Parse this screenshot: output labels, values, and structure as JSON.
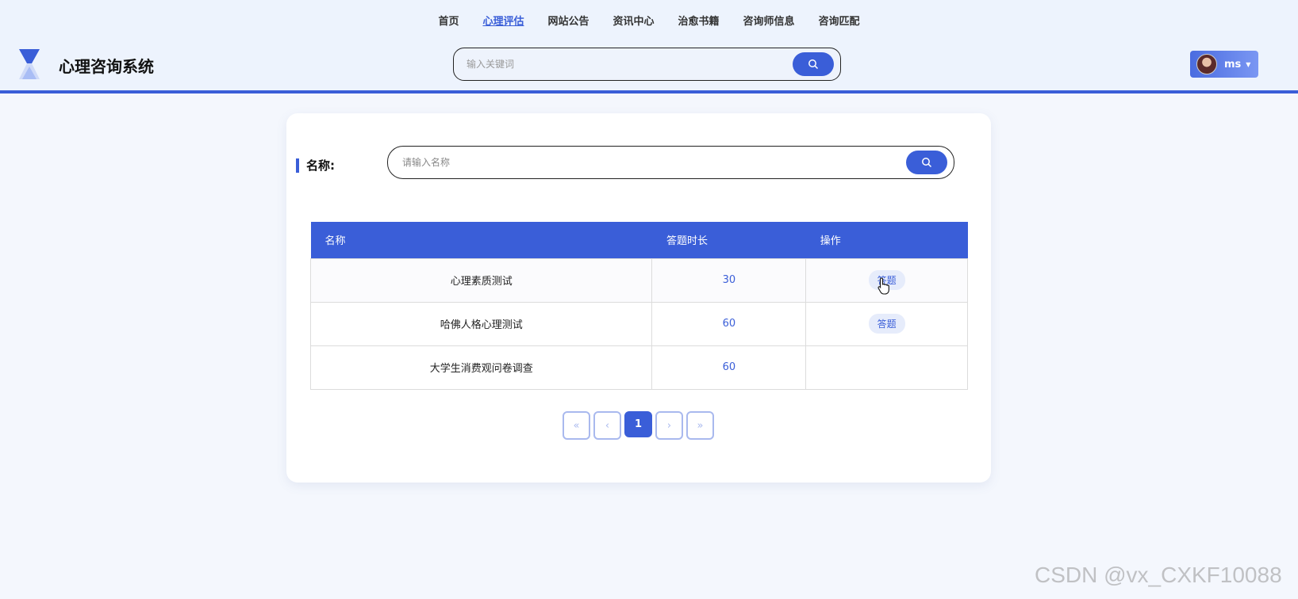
{
  "nav": {
    "items": [
      "首页",
      "心理评估",
      "网站公告",
      "资讯中心",
      "治愈书籍",
      "咨询师信息",
      "咨询匹配"
    ],
    "active_index": 1
  },
  "header": {
    "app_title": "心理咨询系统",
    "search_placeholder": "输入关键词",
    "user_name": "ms"
  },
  "filter": {
    "label": "名称:",
    "placeholder": "请输入名称"
  },
  "table": {
    "columns": [
      "名称",
      "答题时长",
      "操作"
    ],
    "rows": [
      {
        "name": "心理素质测试",
        "duration": "30",
        "action": "答题"
      },
      {
        "name": "哈佛人格心理测试",
        "duration": "60",
        "action": "答题"
      },
      {
        "name": "大学生消费观问卷调查",
        "duration": "60",
        "action": ""
      }
    ]
  },
  "pagination": {
    "first": "«",
    "prev": "‹",
    "current": "1",
    "next": "›",
    "last": "»"
  },
  "watermark": "CSDN @vx_CXKF10088",
  "colors": {
    "accent": "#3a5ed8",
    "header_bg": "#edf3fd"
  }
}
